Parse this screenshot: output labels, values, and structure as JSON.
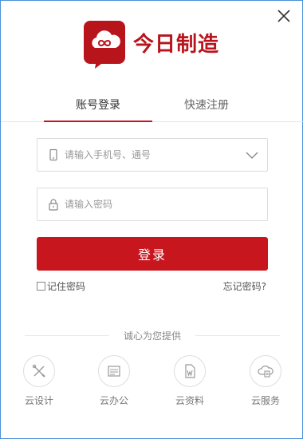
{
  "brand": {
    "name": "今日制造",
    "accent_color": "#c8161e"
  },
  "tabs": [
    {
      "label": "账号登录",
      "active": true
    },
    {
      "label": "快速注册",
      "active": false
    }
  ],
  "form": {
    "account_placeholder": "请输入手机号、通号",
    "password_placeholder": "请输入密码",
    "login_label": "登录",
    "remember_label": "记住密码",
    "remember_checked": false,
    "forgot_label": "忘记密码?"
  },
  "services": {
    "title": "诚心为您提供",
    "items": [
      {
        "label": "云设计",
        "icon": "design-tools-icon"
      },
      {
        "label": "云办公",
        "icon": "office-list-icon"
      },
      {
        "label": "云资料",
        "icon": "document-w-icon"
      },
      {
        "label": "云服务",
        "icon": "cloud-service-icon"
      }
    ]
  }
}
